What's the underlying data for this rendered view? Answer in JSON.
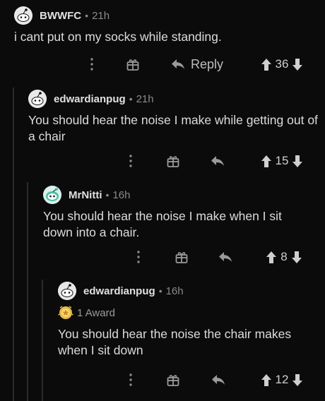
{
  "comments": [
    {
      "username": "BWWFC",
      "separator": "•",
      "time": "21h",
      "body": "i cant put on my socks while standing.",
      "reply_label": "Reply",
      "votes": "36"
    },
    {
      "username": "edwardianpug",
      "separator": "•",
      "time": "21h",
      "body": "You should hear the noise I make while getting out of a chair",
      "votes": "15"
    },
    {
      "username": "MrNitti",
      "separator": "•",
      "time": "16h",
      "body": "You should hear the noise I make when I sit down into a chair.",
      "votes": "8"
    },
    {
      "username": "edwardianpug",
      "separator": "•",
      "time": "16h",
      "award": "1 Award",
      "body": "You should hear the noise the chair makes when I sit down",
      "votes": "12"
    }
  ],
  "icons": {
    "more": "more-vertical-icon",
    "award": "gift-icon",
    "reply": "reply-arrow-icon",
    "upvote": "upvote-arrow-icon",
    "downvote": "downvote-arrow-icon"
  },
  "colors": {
    "background": "#0b0b0b",
    "text": "#dcdcdc",
    "muted": "#8a8a8a",
    "thread_line": "#2b2b2b"
  }
}
